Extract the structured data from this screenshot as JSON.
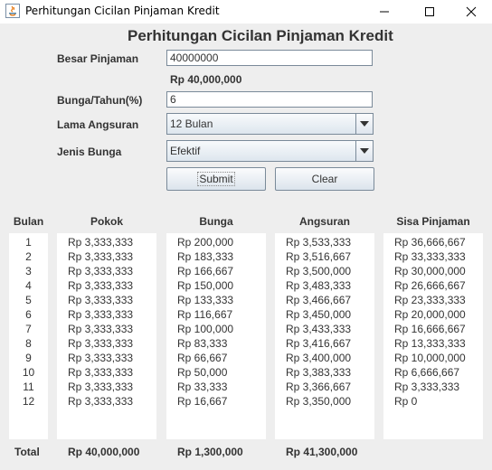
{
  "window": {
    "title": "Perhitungan Cicilan Pinjaman Kredit"
  },
  "form": {
    "heading": "Perhitungan Cicilan Pinjaman Kredit",
    "besar_pinjaman_label": "Besar Pinjaman",
    "besar_pinjaman_value": "40000000",
    "besar_pinjaman_formatted": "Rp 40,000,000",
    "bunga_label": "Bunga/Tahun(%)",
    "bunga_value": "6",
    "lama_label": "Lama Angsuran",
    "lama_value": "12 Bulan",
    "jenis_label": "Jenis Bunga",
    "jenis_value": "Efektif",
    "submit_label": "Submit",
    "clear_label": "Clear"
  },
  "table": {
    "headers": {
      "bulan": "Bulan",
      "pokok": "Pokok",
      "bunga": "Bunga",
      "angsuran": "Angsuran",
      "sisa": "Sisa Pinjaman"
    },
    "rows": [
      {
        "bulan": "1",
        "pokok": "Rp 3,333,333",
        "bunga": "Rp 200,000",
        "angsuran": "Rp 3,533,333",
        "sisa": "Rp 36,666,667"
      },
      {
        "bulan": "2",
        "pokok": "Rp 3,333,333",
        "bunga": "Rp 183,333",
        "angsuran": "Rp 3,516,667",
        "sisa": "Rp 33,333,333"
      },
      {
        "bulan": "3",
        "pokok": "Rp 3,333,333",
        "bunga": "Rp 166,667",
        "angsuran": "Rp 3,500,000",
        "sisa": "Rp 30,000,000"
      },
      {
        "bulan": "4",
        "pokok": "Rp 3,333,333",
        "bunga": "Rp 150,000",
        "angsuran": "Rp 3,483,333",
        "sisa": "Rp 26,666,667"
      },
      {
        "bulan": "5",
        "pokok": "Rp 3,333,333",
        "bunga": "Rp 133,333",
        "angsuran": "Rp 3,466,667",
        "sisa": "Rp 23,333,333"
      },
      {
        "bulan": "6",
        "pokok": "Rp 3,333,333",
        "bunga": "Rp 116,667",
        "angsuran": "Rp 3,450,000",
        "sisa": "Rp 20,000,000"
      },
      {
        "bulan": "7",
        "pokok": "Rp 3,333,333",
        "bunga": "Rp 100,000",
        "angsuran": "Rp 3,433,333",
        "sisa": "Rp 16,666,667"
      },
      {
        "bulan": "8",
        "pokok": "Rp 3,333,333",
        "bunga": "Rp 83,333",
        "angsuran": "Rp 3,416,667",
        "sisa": "Rp 13,333,333"
      },
      {
        "bulan": "9",
        "pokok": "Rp 3,333,333",
        "bunga": "Rp 66,667",
        "angsuran": "Rp 3,400,000",
        "sisa": "Rp 10,000,000"
      },
      {
        "bulan": "10",
        "pokok": "Rp 3,333,333",
        "bunga": "Rp 50,000",
        "angsuran": "Rp 3,383,333",
        "sisa": "Rp 6,666,667"
      },
      {
        "bulan": "11",
        "pokok": "Rp 3,333,333",
        "bunga": "Rp 33,333",
        "angsuran": "Rp 3,366,667",
        "sisa": "Rp 3,333,333"
      },
      {
        "bulan": "12",
        "pokok": "Rp 3,333,333",
        "bunga": "Rp 16,667",
        "angsuran": "Rp 3,350,000",
        "sisa": "Rp 0"
      }
    ],
    "totals": {
      "label": "Total",
      "pokok": "Rp 40,000,000",
      "bunga": "Rp 1,300,000",
      "angsuran": "Rp 41,300,000"
    }
  }
}
